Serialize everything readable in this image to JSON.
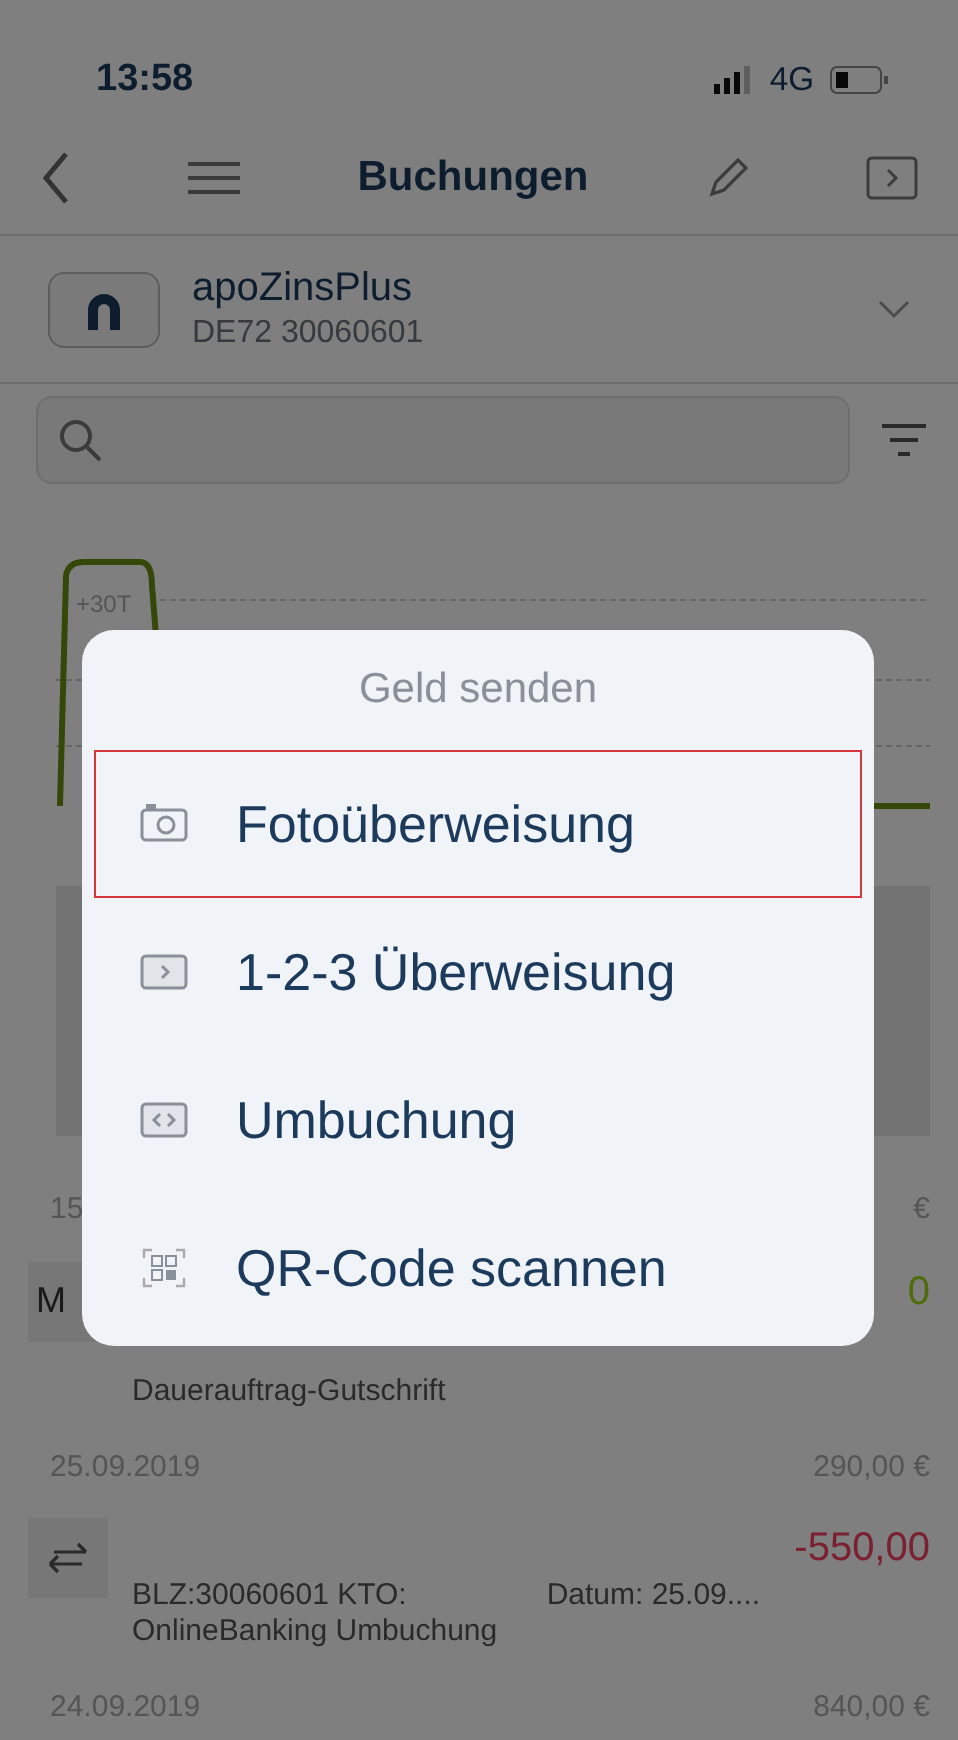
{
  "status_bar": {
    "time": "13:58",
    "network": "4G"
  },
  "nav": {
    "title": "Buchungen"
  },
  "account": {
    "name": "apoZinsPlus",
    "iban": "DE72 30060601"
  },
  "chart": {
    "tick_label": "+30T"
  },
  "day_groups": [
    {
      "date": "15",
      "total": "€",
      "entries": [
        {
          "kind": "letter",
          "badge": "M",
          "amount": "0",
          "color": "#4f6b0a",
          "description": "Dauerauftrag-Gutschrift"
        }
      ]
    },
    {
      "date": "25.09.2019",
      "total": "290,00 €",
      "entries": [
        {
          "kind": "transfer",
          "amount": "-550,00",
          "color": "#7a2030",
          "detail_left": "BLZ:30060601 KTO:",
          "detail_right": "Datum: 25.09....",
          "description": "OnlineBanking Umbuchung"
        }
      ]
    },
    {
      "date": "24.09.2019",
      "total": "840,00 €"
    }
  ],
  "dialog": {
    "title": "Geld senden",
    "items": [
      {
        "kind": "camera",
        "label": "Fotoüberweisung",
        "selected": true
      },
      {
        "kind": "forward",
        "label": "1-2-3 Überweisung",
        "selected": false
      },
      {
        "kind": "swap",
        "label": "Umbuchung",
        "selected": false
      },
      {
        "kind": "qr",
        "label": "QR-Code scannen",
        "selected": false
      }
    ]
  }
}
